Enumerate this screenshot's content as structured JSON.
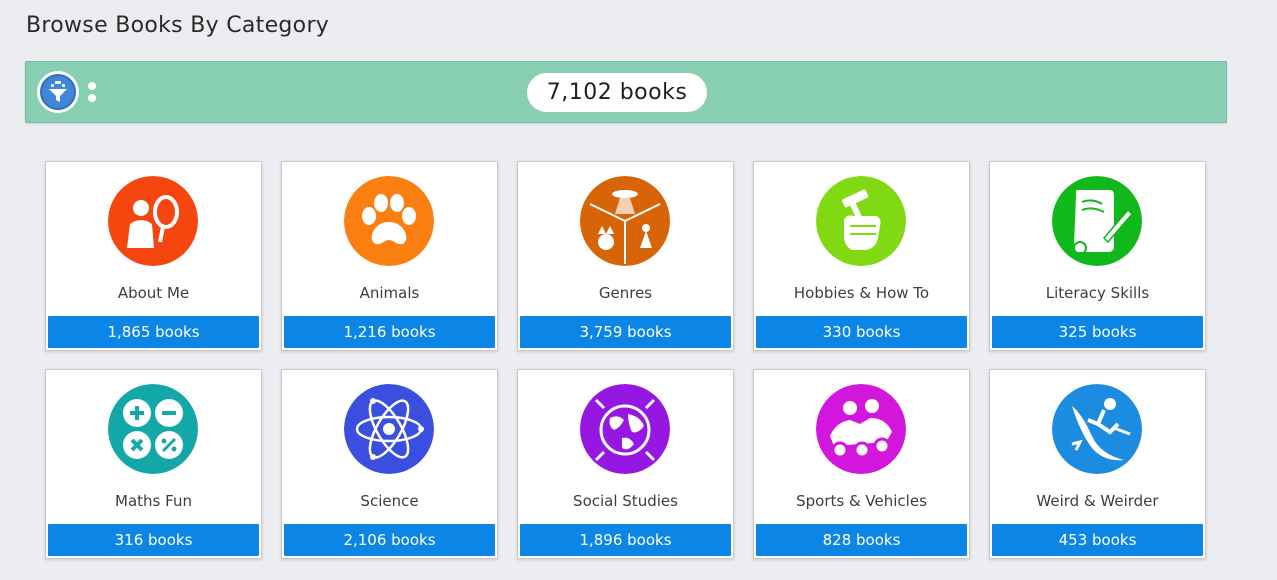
{
  "page": {
    "title": "Browse Books By Category"
  },
  "toolbar": {
    "filter_icon": "funnel-icon",
    "more_icon": "vertical-dots-icon",
    "total_count": "7,102 books",
    "background": "#88ceb3"
  },
  "categories": [
    {
      "label": "About Me",
      "count": "1,865 books",
      "color": "#f5460f",
      "icon": "person-mirror-icon"
    },
    {
      "label": "Animals",
      "count": "1,216 books",
      "color": "#fb7f10",
      "icon": "paw-print-icon"
    },
    {
      "label": "Genres",
      "count": "3,759 books",
      "color": "#d86408",
      "icon": "genres-collage-icon"
    },
    {
      "label": "Hobbies & How To",
      "count": "330 books",
      "color": "#80d913",
      "icon": "fist-hammer-icon"
    },
    {
      "label": "Literacy Skills",
      "count": "325 books",
      "color": "#11b81c",
      "icon": "scroll-quill-icon"
    },
    {
      "label": "Maths Fun",
      "count": "316 books",
      "color": "#13a7a8",
      "icon": "math-operators-icon"
    },
    {
      "label": "Science",
      "count": "2,106 books",
      "color": "#3a4fe0",
      "icon": "atom-icon"
    },
    {
      "label": "Social Studies",
      "count": "1,896 books",
      "color": "#9517e1",
      "icon": "globe-icon"
    },
    {
      "label": "Sports & Vehicles",
      "count": "828 books",
      "color": "#d216dc",
      "icon": "go-kart-icon"
    },
    {
      "label": "Weird & Weirder",
      "count": "453 books",
      "color": "#1c8ce0",
      "icon": "surfer-icon"
    }
  ]
}
